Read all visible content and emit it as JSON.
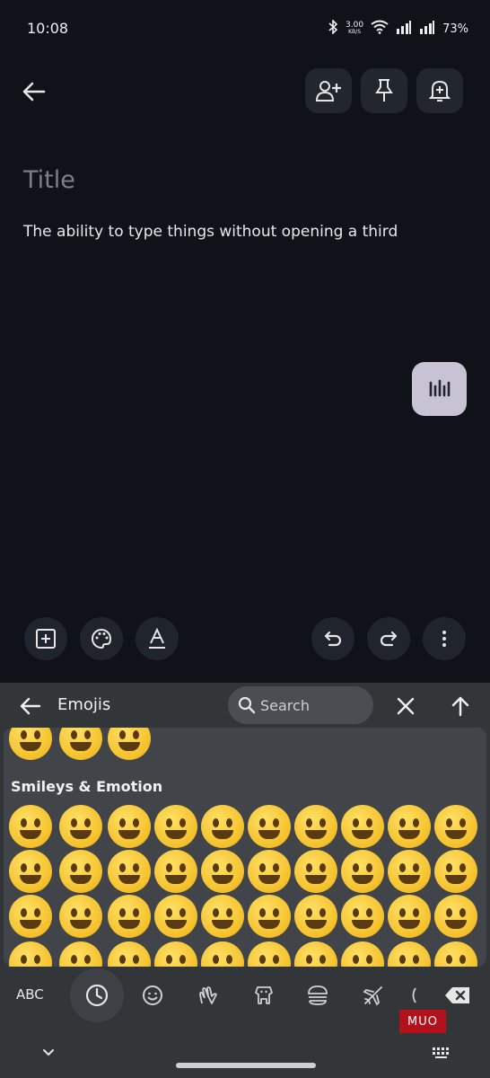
{
  "status_bar": {
    "time": "10:08",
    "net_speed": "3.00",
    "net_unit": "KB/S",
    "battery": "73%"
  },
  "note": {
    "title_placeholder": "Title",
    "body": "The ability to type things without opening a third"
  },
  "keyboard": {
    "header_title": "Emojis",
    "search_placeholder": "Search",
    "category_label": "Smileys & Emotion",
    "abc_label": "ABC",
    "watermark": "MUO"
  },
  "colors": {
    "background": "#0f1219",
    "keyboard": "#333639",
    "emoji_panel": "#414449",
    "fab": "#c7c2d4"
  }
}
